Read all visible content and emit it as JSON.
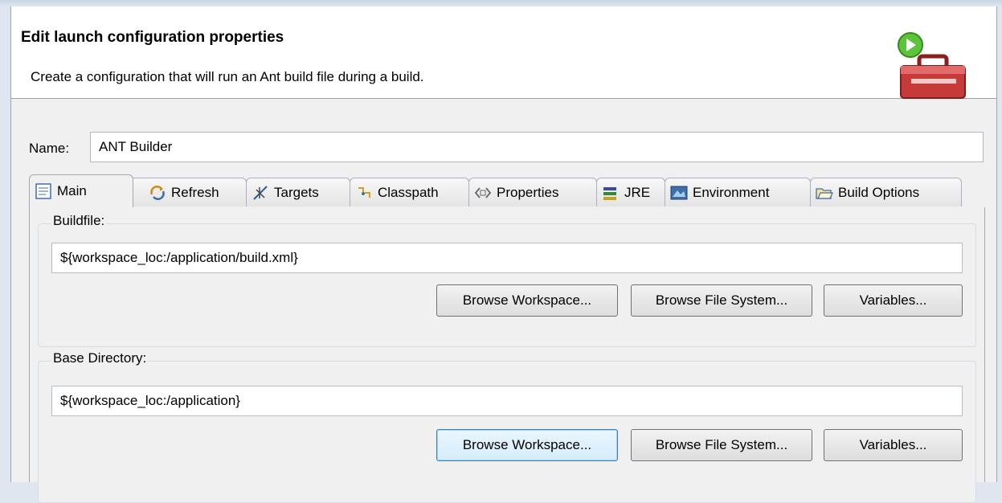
{
  "header": {
    "title": "Edit launch configuration properties",
    "description": "Create a configuration that will run an Ant build file during a build."
  },
  "name": {
    "label": "Name:",
    "value": "ANT Builder"
  },
  "tabs": [
    {
      "label": "Main",
      "icon": "document-icon"
    },
    {
      "label": "Refresh",
      "icon": "refresh-icon"
    },
    {
      "label": "Targets",
      "icon": "targets-icon"
    },
    {
      "label": "Classpath",
      "icon": "classpath-icon"
    },
    {
      "label": "Properties",
      "icon": "properties-icon"
    },
    {
      "label": "JRE",
      "icon": "jre-icon"
    },
    {
      "label": "Environment",
      "icon": "environment-icon"
    },
    {
      "label": "Build Options",
      "icon": "folder-icon"
    }
  ],
  "buildfile": {
    "label": "Buildfile:",
    "value": "${workspace_loc:/application/build.xml}",
    "browse_workspace": "Browse Workspace...",
    "browse_fs": "Browse File System...",
    "variables": "Variables..."
  },
  "basedir": {
    "label": "Base Directory:",
    "value": "${workspace_loc:/application}",
    "browse_workspace": "Browse Workspace...",
    "browse_fs": "Browse File System...",
    "variables": "Variables..."
  },
  "colors": {
    "accent": "#3c7fb1",
    "header_bg": "#ffffff",
    "dialog_bg": "#f0f0f0"
  }
}
